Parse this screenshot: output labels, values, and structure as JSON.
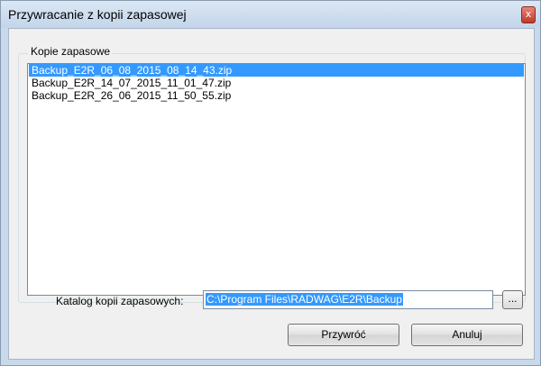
{
  "window": {
    "title": "Przywracanie z kopii zapasowej",
    "close_glyph": "x"
  },
  "group": {
    "legend": "Kopie zapasowe"
  },
  "backups": [
    {
      "name": "Backup_E2R_06_08_2015_08_14_43.zip",
      "selected": true
    },
    {
      "name": "Backup_E2R_14_07_2015_11_01_47.zip",
      "selected": false
    },
    {
      "name": "Backup_E2R_26_06_2015_11_50_55.zip",
      "selected": false
    }
  ],
  "directory": {
    "label": "Katalog kopii zapasowych:",
    "value": "C:\\Program Files\\RADWAG\\E2R\\Backup",
    "browse_label": "..."
  },
  "buttons": {
    "restore": "Przywróć",
    "cancel": "Anuluj"
  },
  "colors": {
    "selection": "#3399ff",
    "title_bar": "#c9d9ec"
  }
}
